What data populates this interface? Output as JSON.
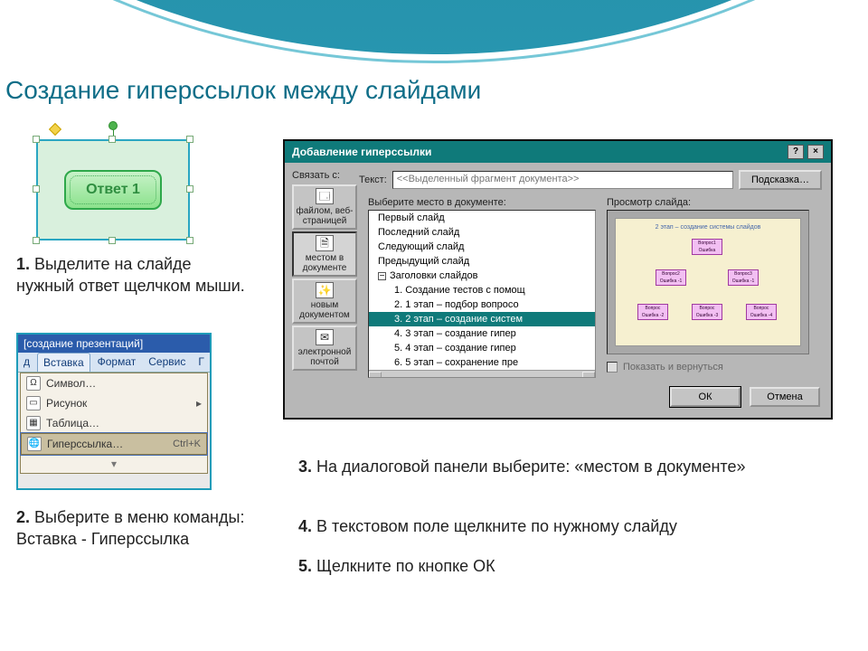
{
  "title": "Создание гиперссылок между слайдами",
  "answer_button_label": "Ответ 1",
  "steps": {
    "s1_num": "1.",
    "s1_txt": " Выделите на слайде нужный ответ щелчком мыши.",
    "s2_num": "2.",
    "s2_txt": " Выберите в меню команды:",
    "s2_line2": "Вставка - Гиперссылка",
    "s3_num": "3.",
    "s3_txt": " На диалоговой панели выберите: «местом в документе»",
    "s4_num": "4.",
    "s4_txt": " В текстовом поле щелкните по нужному слайду",
    "s5_num": "5.",
    "s5_txt": " Щелкните по кнопке ОК"
  },
  "menu": {
    "caption": "[создание презентаций]",
    "tabs": [
      "д",
      "Вставка",
      "Формат",
      "Сервис",
      "Г"
    ],
    "items": {
      "symbol": "Символ…",
      "picture": "Рисунок",
      "table": "Таблица…",
      "hyperlink": "Гиперссылка…",
      "hyperlink_shortcut": "Ctrl+K"
    }
  },
  "dialog": {
    "title": "Добавление гиперссылки",
    "help_btn": "?",
    "close_btn": "×",
    "link_with_label": "Связать с:",
    "text_label": "Текст:",
    "text_value": "<<Выделенный фрагмент документа>>",
    "hint_btn": "Подсказка…",
    "link_targets": {
      "file": "файлом, веб-страницей",
      "place": "местом в документе",
      "newdoc": "новым документом",
      "email": "электронной почтой"
    },
    "tree_label": "Выберите место в документе:",
    "tree": {
      "first": "Первый слайд",
      "last": "Последний слайд",
      "next": "Следующий слайд",
      "prev": "Предыдущий слайд",
      "titles": "Заголовки слайдов",
      "i1": "1. Создание тестов с помощ",
      "i2": "2. 1 этап – подбор вопросо",
      "i3": "3. 2 этап – создание систем",
      "i4": "4. 3 этап – создание гипер",
      "i5": "5. 4 этап – создание гипер",
      "i6": "6. 5 этап – сохранение пре"
    },
    "preview_label": "Просмотр слайда:",
    "preview_title": "2 этап – создание системы слайдов",
    "nodes": {
      "q1": "Вопрос1 Ошибка",
      "q2": "Вопрос2 Ошибка -1",
      "q3": "Вопрос3 Ошибка -1",
      "a1": "Вопрос Ошибка -2",
      "a2": "Вопрос Ошибка -3",
      "a3": "Вопрос Ошибка -4"
    },
    "show_return": "Показать и вернуться",
    "ok": "ОК",
    "cancel": "Отмена"
  }
}
